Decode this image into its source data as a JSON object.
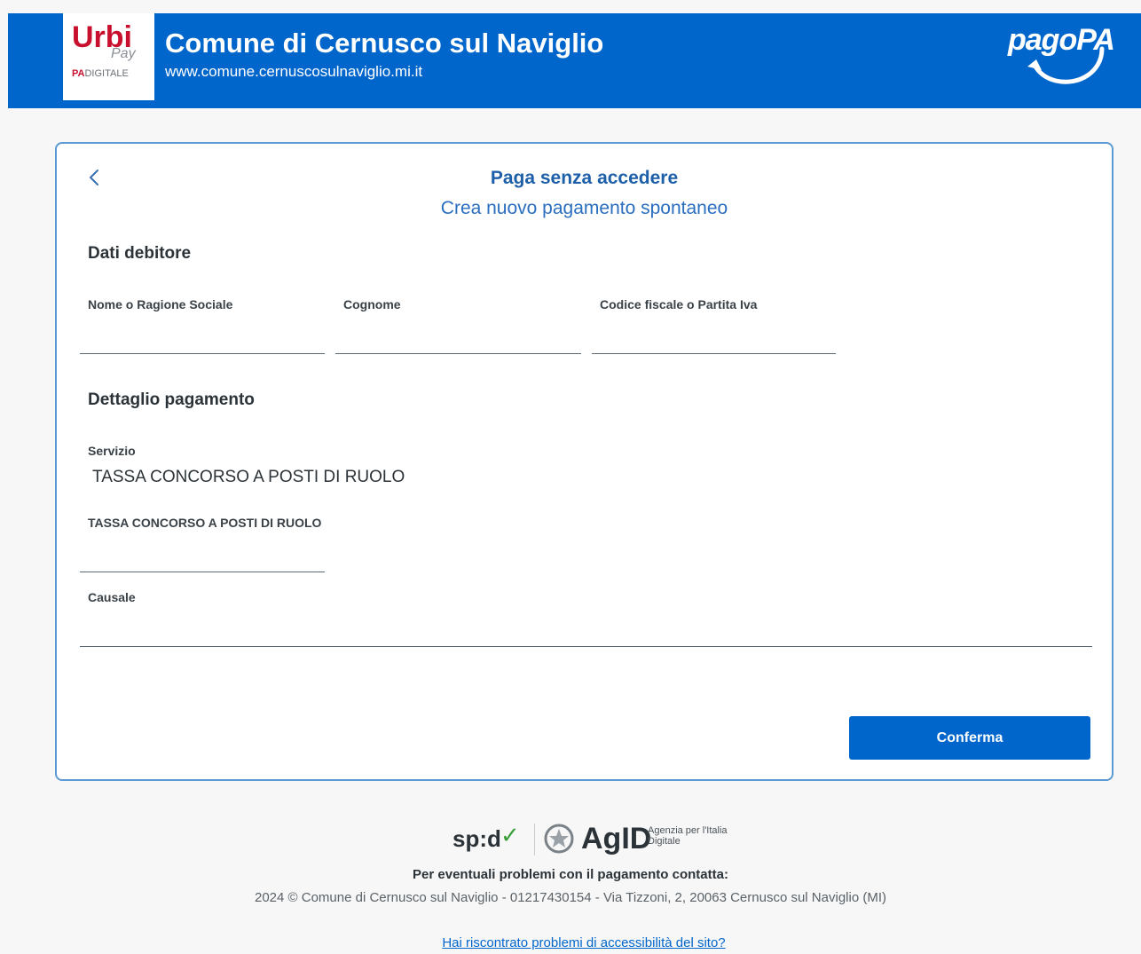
{
  "header": {
    "brand_logo_text": "Urbi",
    "brand_logo_sub": "Pay",
    "brand_logo_pa": "PA",
    "brand_logo_digitale": "DIGITALE",
    "title": "Comune di Cernusco sul Naviglio",
    "url": "www.comune.cernuscosulnaviglio.mi.it",
    "pagopa_logo_text": "pagoPA"
  },
  "card": {
    "back_icon": "chevron-left-icon",
    "title": "Paga senza accedere",
    "subtitle": "Crea nuovo pagamento spontaneo",
    "debtor_section": {
      "title": "Dati debitore",
      "fields": [
        {
          "label": "Nome o Ragione Sociale",
          "value": ""
        },
        {
          "label": "Cognome",
          "value": ""
        },
        {
          "label": "Codice fiscale o Partita Iva",
          "value": ""
        }
      ]
    },
    "payment_section": {
      "title": "Dettaglio pagamento",
      "service_label": "Servizio",
      "service_value": "TASSA CONCORSO A POSTI DI RUOLO",
      "amount_label": "TASSA CONCORSO A POSTI DI RUOLO",
      "amount_value": "",
      "reason_label": "Causale",
      "reason_value": ""
    },
    "confirm_label": "Conferma"
  },
  "footer": {
    "spid_logo_text": "sp:d",
    "agid_logo_text": "AgID",
    "agid_logo_sub": "Agenzia per l'Italia Digitale",
    "contact": "Per eventuali problemi con il pagamento contatta:",
    "copyright": "2024 © Comune di Cernusco sul Naviglio - 01217430154 - Via Tizzoni, 2, 20063 Cernusco sul Naviglio (MI)",
    "accessibility_link": "Hai riscontrato problemi di accessibilità del sito?"
  },
  "colors": {
    "primary": "#0066cc",
    "card_border": "#5c9ad6",
    "brand_red": "#c8102e"
  }
}
